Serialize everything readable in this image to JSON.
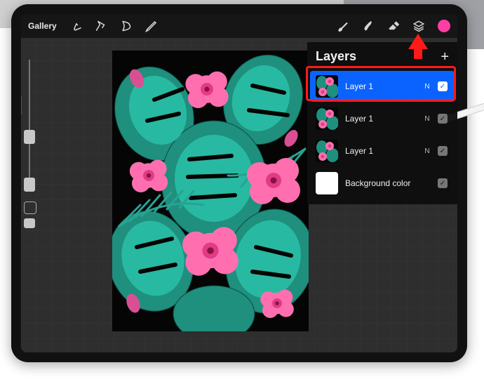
{
  "topbar": {
    "gallery_label": "Gallery",
    "color_hex": "#ff3ea5"
  },
  "panel": {
    "title": "Layers"
  },
  "layers": [
    {
      "name": "Layer 1",
      "blend": "N",
      "selected": true,
      "checked": true,
      "thumb": "floral"
    },
    {
      "name": "Layer 1",
      "blend": "N",
      "selected": false,
      "checked": true,
      "thumb": "floral"
    },
    {
      "name": "Layer 1",
      "blend": "N",
      "selected": false,
      "checked": true,
      "thumb": "floral"
    },
    {
      "name": "Background color",
      "blend": "",
      "selected": false,
      "checked": true,
      "thumb": "white"
    }
  ],
  "annotation": {
    "arrow_target": "layers-button"
  }
}
